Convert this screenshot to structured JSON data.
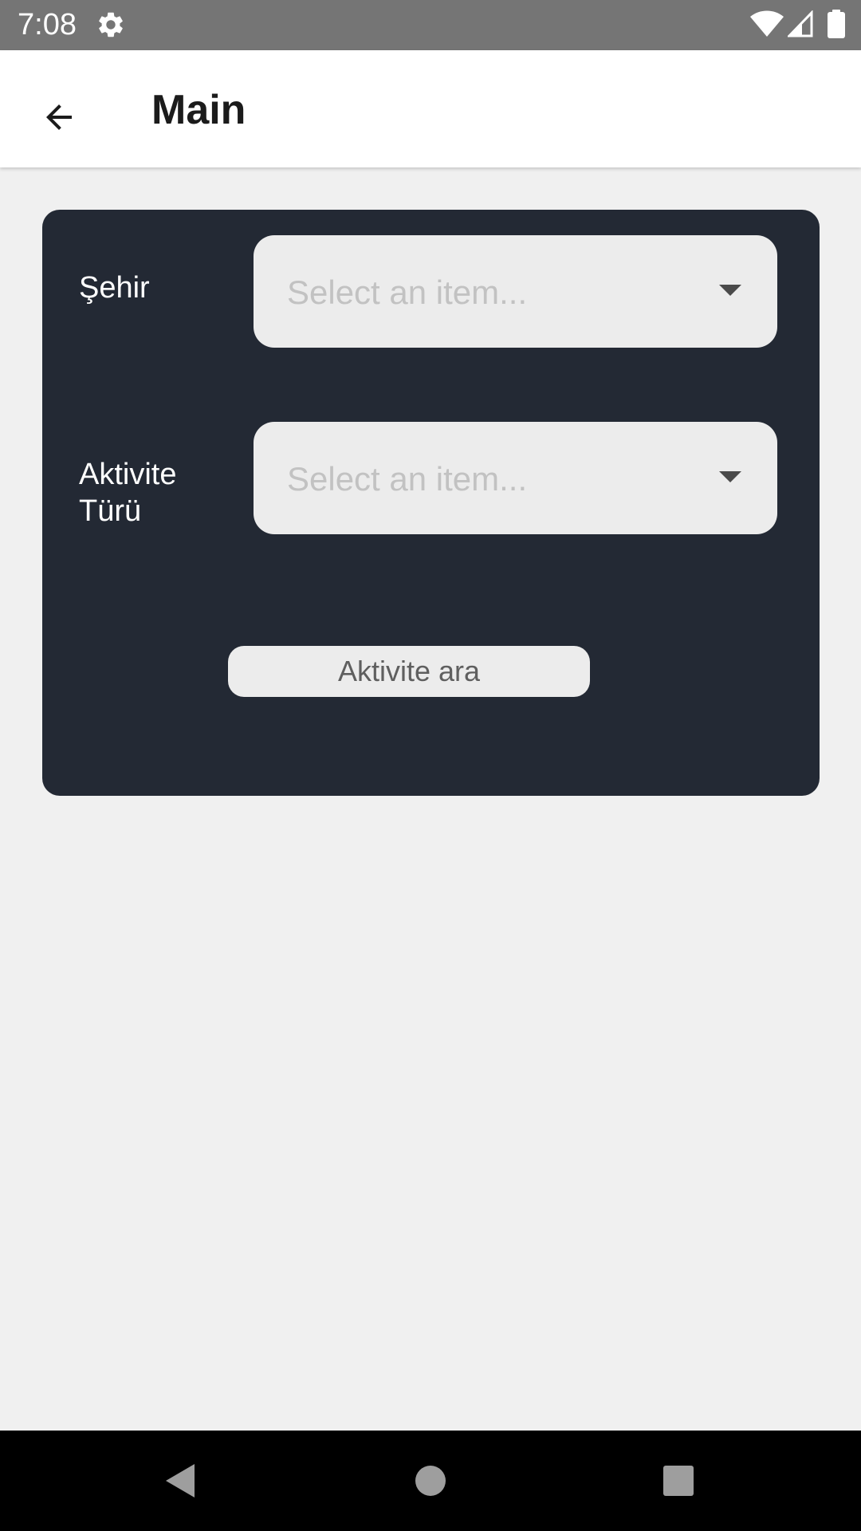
{
  "status_bar": {
    "time": "7:08",
    "icons": [
      "gear-icon",
      "wifi-icon",
      "signal-icon",
      "battery-icon"
    ]
  },
  "app_bar": {
    "back_icon": "arrow-left-icon",
    "title": "Main"
  },
  "form": {
    "city": {
      "label": "Şehir",
      "placeholder": "Select an item..."
    },
    "activity_type": {
      "label": "Aktivite\nTürü",
      "placeholder": "Select an item..."
    },
    "search_button_label": "Aktivite ara"
  },
  "nav_bar": {
    "icons": [
      "nav-back-icon",
      "nav-home-icon",
      "nav-recents-icon"
    ]
  },
  "colors": {
    "card": "#232934",
    "background": "#f0f0f0",
    "status_bar": "#757575"
  }
}
